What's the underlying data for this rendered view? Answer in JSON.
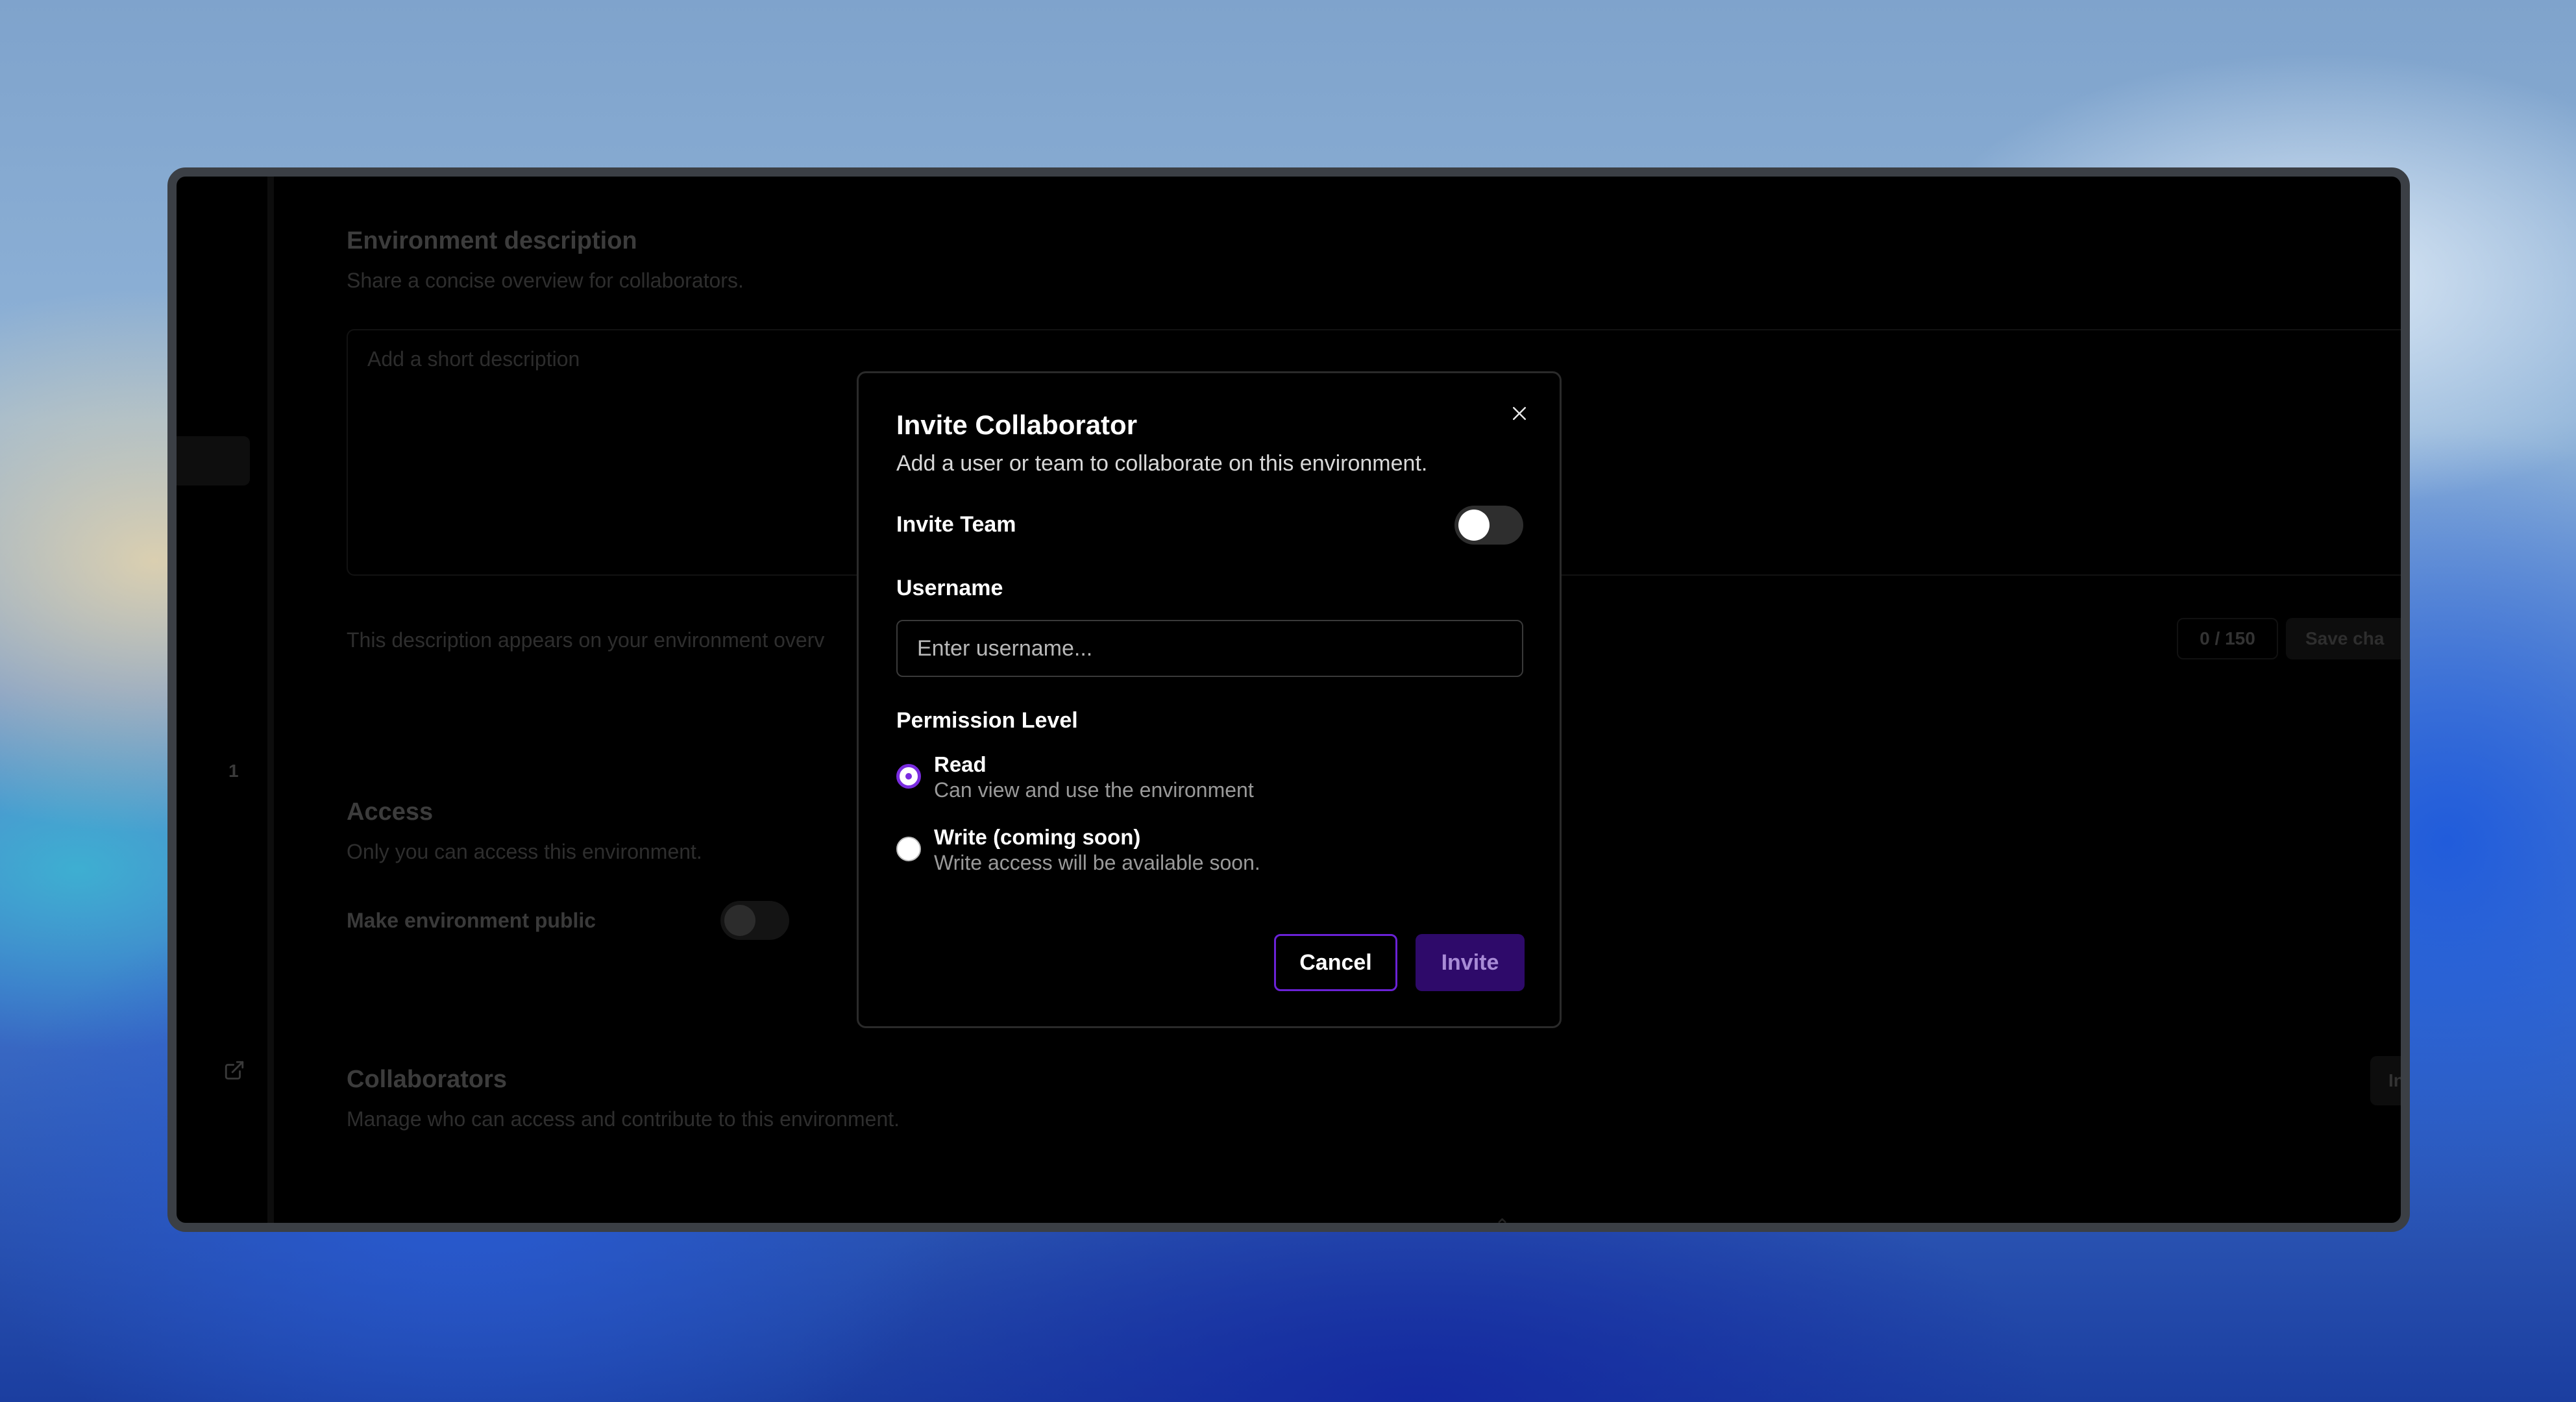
{
  "background_page": {
    "rail": {
      "number": "1"
    },
    "description_section": {
      "title": "Environment description",
      "subtitle": "Share a concise overview for collaborators.",
      "textarea_placeholder": "Add a short description",
      "helper_text": "This description appears on your environment overv",
      "counter": "0 / 150",
      "save_button": "Save cha"
    },
    "access_section": {
      "title": "Access",
      "subtitle": "Only you can access this environment.",
      "public_toggle_label": "Make environment public",
      "public_toggle_on": false
    },
    "collaborators_section": {
      "title": "Collaborators",
      "subtitle": "Manage who can access and contribute to this environment.",
      "invite_button": "Invite collabor"
    }
  },
  "modal": {
    "title": "Invite Collaborator",
    "subtitle": "Add a user or team to collaborate on this environment.",
    "invite_team_label": "Invite Team",
    "invite_team_on": false,
    "username_label": "Username",
    "username_placeholder": "Enter username...",
    "username_value": "",
    "permission_label": "Permission Level",
    "permissions": [
      {
        "title": "Read",
        "description": "Can view and use the environment",
        "selected": true
      },
      {
        "title": "Write (coming soon)",
        "description": "Write access will be available soon.",
        "selected": false
      }
    ],
    "cancel_label": "Cancel",
    "invite_label": "Invite"
  },
  "colors": {
    "accent": "#7a2ce0",
    "invite_button_bg": "#2e0a6a",
    "modal_bg": "#000000"
  },
  "icons": {
    "close": "close-icon",
    "external_link": "external-link-icon"
  }
}
